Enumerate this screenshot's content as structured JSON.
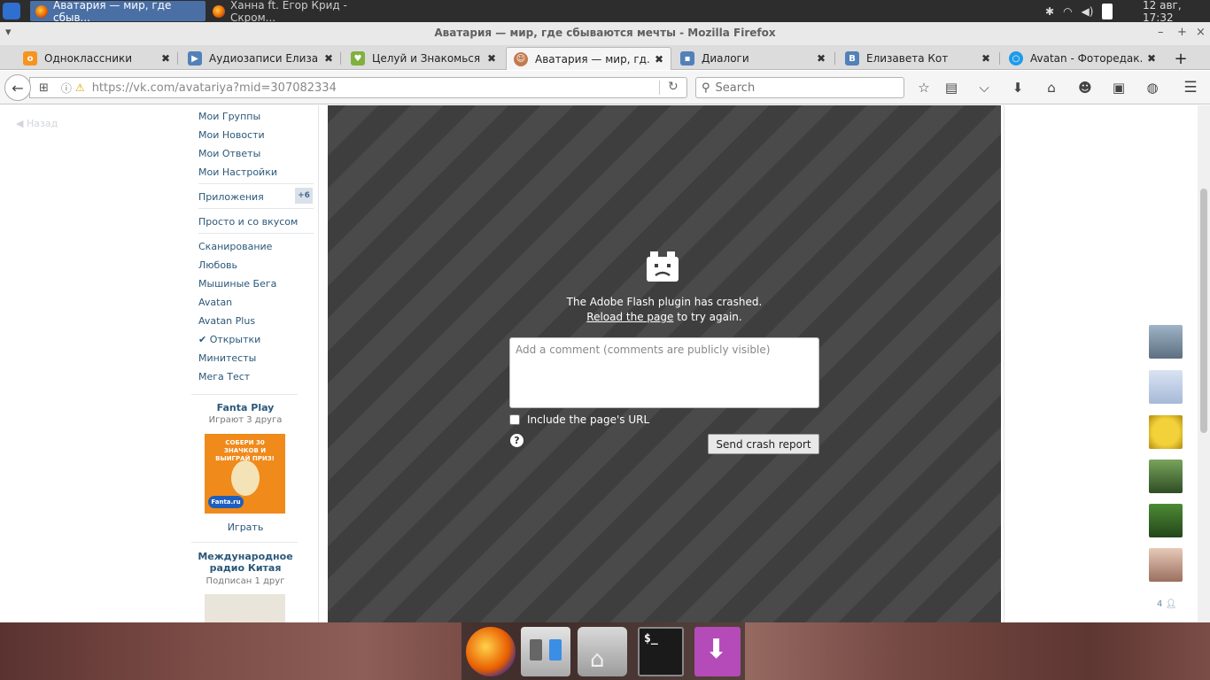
{
  "system_panel": {
    "tasks": [
      {
        "label": "Аватария — мир, где сбыв...",
        "active": true
      },
      {
        "label": "Ханна ft. Егор Крид - Скром...",
        "active": false
      }
    ],
    "clock": "12 авг, 17:32"
  },
  "window": {
    "title": "Аватария — мир, где сбываются мечты - Mozilla Firefox"
  },
  "tabs": [
    {
      "label": "Одноклассники",
      "icon": "odnoklassniki-icon",
      "color": "#f7931e"
    },
    {
      "label": "Аудиозаписи Елиза...",
      "icon": "play-icon",
      "color": "#5181b8"
    },
    {
      "label": "Целуй и Знакомься",
      "icon": "heart-app-icon",
      "color": "#7fb13f"
    },
    {
      "label": "Аватария — мир, гд...",
      "icon": "avatar-face-icon",
      "color": "#c27b4f"
    },
    {
      "label": "Диалоги",
      "icon": "chat-icon",
      "color": "#5181b8"
    },
    {
      "label": "Елизавета Кот",
      "icon": "vk-icon",
      "color": "#5181b8"
    },
    {
      "label": "Avatan - Фоторедак...",
      "icon": "avatan-icon",
      "color": "#1e9be9"
    }
  ],
  "navbar": {
    "url_host": "https://vk.com",
    "url_path": "/avatariya?mid=307082334",
    "search_placeholder": "Search"
  },
  "left_menu": {
    "back": "Назад",
    "items_top": [
      "Мои Группы",
      "Мои Новости",
      "Мои Ответы",
      "Мои Настройки"
    ],
    "apps_label": "Приложения",
    "apps_badge": "+6",
    "featured": "Просто и со вкусом",
    "apps": [
      "Сканирование",
      "Любовь",
      "Мышиные Бега",
      "Avatan",
      "Avatan Plus",
      "✔ Открытки",
      "Минитесты",
      "Мега Тест"
    ],
    "ad1": {
      "title": "Fanta Play",
      "subtitle": "Играют 3 друга",
      "img_text": "СОБЕРИ 30 ЗНАЧКОВ И ВЫИГРАЙ ПРИЗ!",
      "brand": "Fanta.ru",
      "action": "Играть"
    },
    "ad2": {
      "title_line1": "Международное",
      "title_line2": "радио Китая",
      "subtitle": "Подписан 1 друг"
    }
  },
  "flash_crash": {
    "message": "The Adobe Flash plugin has crashed.",
    "reload_link": "Reload the page",
    "reload_suffix": " to try again.",
    "comment_placeholder": "Add a comment (comments are publicly visible)",
    "include_url_label": "Include the page's URL",
    "include_url_checked": false,
    "send_button": "Send crash report",
    "help_glyph": "?"
  },
  "friends": {
    "count": "4",
    "avatar_colors": [
      "#6d8299",
      "#b9c6e0",
      "#d7a81e",
      "#4f7a3b",
      "#3b6b2e",
      "#c79c86"
    ]
  }
}
